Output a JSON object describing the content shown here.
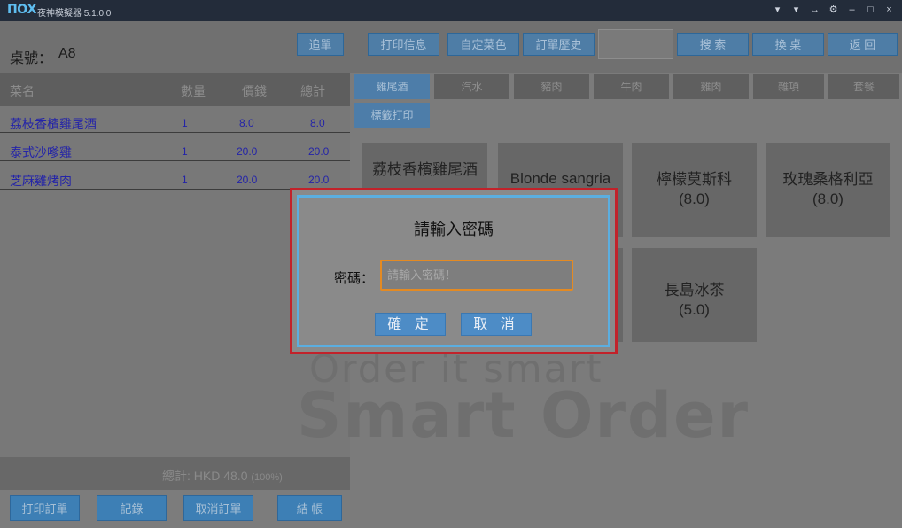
{
  "window": {
    "logo": "ПОХ",
    "title": "夜神模擬器 5.1.0.0",
    "controls": [
      "▾",
      "▾",
      "↔",
      "⚙",
      "–",
      "□",
      "×"
    ]
  },
  "header": {
    "table_label": "桌號：",
    "table_value": "A8",
    "buttons": [
      "追單",
      "打印信息",
      "自定菜色",
      "訂單歷史",
      "搜 索",
      "換 桌",
      "返 回"
    ],
    "search_value": ""
  },
  "order": {
    "columns": [
      "菜名",
      "數量",
      "價錢",
      "總計"
    ],
    "rows": [
      {
        "name": "荔枝香檳雞尾酒",
        "qty": "1",
        "price": "8.0",
        "total": "8.0"
      },
      {
        "name": "泰式沙嗲雞",
        "qty": "1",
        "price": "20.0",
        "total": "20.0"
      },
      {
        "name": "芝麻雞烤肉",
        "qty": "1",
        "price": "20.0",
        "total": "20.0"
      }
    ],
    "total_text": "總計: HKD 48.0",
    "total_pct": "(100%)",
    "bottom_buttons": [
      "打印訂單",
      "記錄",
      "取消訂單",
      "結 帳"
    ]
  },
  "categories": [
    "雞尾酒",
    "汽水",
    "豬肉",
    "牛肉",
    "雞肉",
    "雜項",
    "套餐",
    "標籤打印"
  ],
  "items": [
    {
      "name": "荔枝香檳雞尾酒",
      "price": ""
    },
    {
      "name": "Blonde sangria",
      "price": ""
    },
    {
      "name": "檸檬莫斯科",
      "price": "(8.0)"
    },
    {
      "name": "玫瑰桑格利亞",
      "price": "(8.0)"
    },
    {
      "name": "",
      "price": ""
    },
    {
      "name": "長島冰茶",
      "price": "(5.0)"
    }
  ],
  "watermark": {
    "line1": "Order it smart",
    "line2": "Smart Order"
  },
  "dialog": {
    "title": "請輸入密碼",
    "label": "密碼：",
    "placeholder": "請輸入密碼！",
    "value": "",
    "confirm": "確 定",
    "cancel": "取 消"
  },
  "colors": {
    "dialog_border_highlight": "#c2222a",
    "dialog_border": "#5baee0",
    "input_focus": "#e48a22",
    "button_blue": "#3d7fb5",
    "order_text": "#2424a8"
  }
}
